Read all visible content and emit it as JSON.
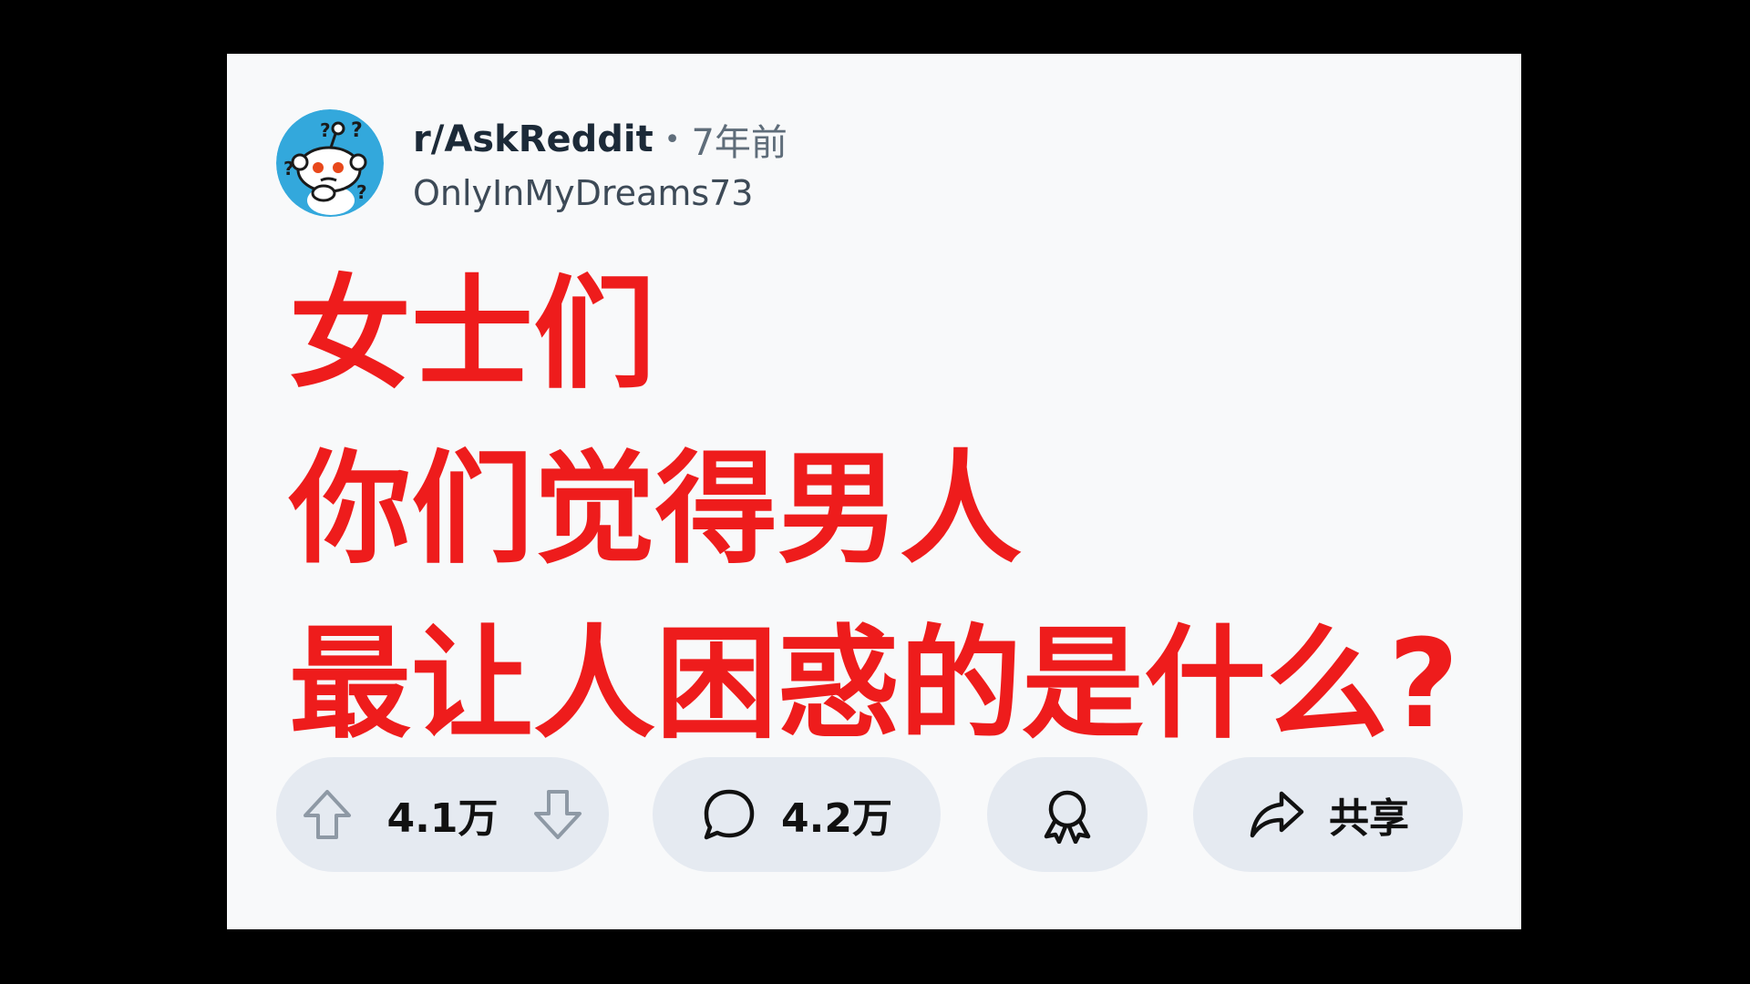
{
  "post": {
    "subreddit": "r/AskReddit",
    "separator": "•",
    "time_ago": "7年前",
    "author": "OnlyInMyDreams73",
    "title_lines": [
      "女士们",
      "你们觉得男人",
      "最让人困惑的是什么?"
    ]
  },
  "actions": {
    "votes": "4.1万",
    "comments": "4.2万",
    "share_label": "共享"
  },
  "icons": {
    "upvote": "arrow-up-icon",
    "downvote": "arrow-down-icon",
    "comment": "comment-bubble-icon",
    "award": "award-ribbon-icon",
    "share": "share-arrow-icon",
    "avatar": "snoo-confused-avatar"
  },
  "colors": {
    "title": "#ee1c1c",
    "card_bg": "#f8f9fa",
    "pill_bg": "#e5eaf1",
    "avatar_bg": "#33a8dc"
  }
}
